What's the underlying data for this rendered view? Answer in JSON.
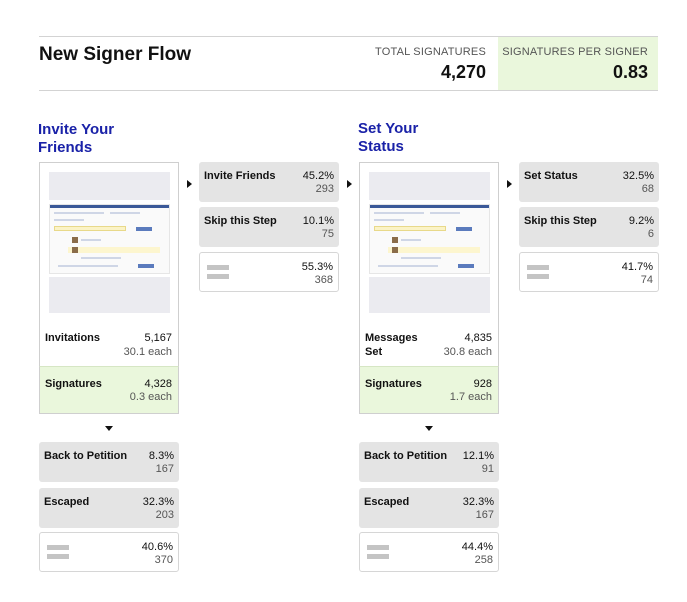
{
  "header": {
    "title": "New Signer Flow",
    "total_label": "TOTAL SIGNATURES",
    "total_value": "4,270",
    "per_label": "SIGNATURES PER SIGNER",
    "per_value": "0.83"
  },
  "colors": {
    "title_blue": "#1a22a8",
    "green_bg": "#eaf7dc",
    "gray_box": "#e4e4e4"
  },
  "sections": [
    {
      "title_line1": "Invite Your",
      "title_line2": "Friends",
      "metric_label": "Invitations",
      "metric_label2": "",
      "metric_value": "5,167",
      "metric_sub": "30.1 each",
      "signatures_label": "Signatures",
      "signatures_value": "4,328",
      "signatures_sub": "0.3 each",
      "options": [
        {
          "label": "Invite Friends",
          "pct": "45.2%",
          "count": "293"
        },
        {
          "label": "Skip this Step",
          "pct": "10.1%",
          "count": "75"
        },
        {
          "label": "",
          "pct": "55.3%",
          "count": "368"
        }
      ],
      "exits": [
        {
          "label": "Back to Petition",
          "pct": "8.3%",
          "count": "167"
        },
        {
          "label": "Escaped",
          "pct": "32.3%",
          "count": "203"
        },
        {
          "label": "",
          "pct": "40.6%",
          "count": "370"
        }
      ]
    },
    {
      "title_line1": "Set Your",
      "title_line2": "Status",
      "metric_label": "Messages",
      "metric_label2": "Set",
      "metric_value": "4,835",
      "metric_sub": "30.8 each",
      "signatures_label": "Signatures",
      "signatures_value": "928",
      "signatures_sub": "1.7 each",
      "options": [
        {
          "label": "Set Status",
          "pct": "32.5%",
          "count": "68"
        },
        {
          "label": "Skip this Step",
          "pct": "9.2%",
          "count": "6"
        },
        {
          "label": "",
          "pct": "41.7%",
          "count": "74"
        }
      ],
      "exits": [
        {
          "label": "Back to Petition",
          "pct": "12.1%",
          "count": "91"
        },
        {
          "label": "Escaped",
          "pct": "32.3%",
          "count": "167"
        },
        {
          "label": "",
          "pct": "44.4%",
          "count": "258"
        }
      ]
    }
  ]
}
